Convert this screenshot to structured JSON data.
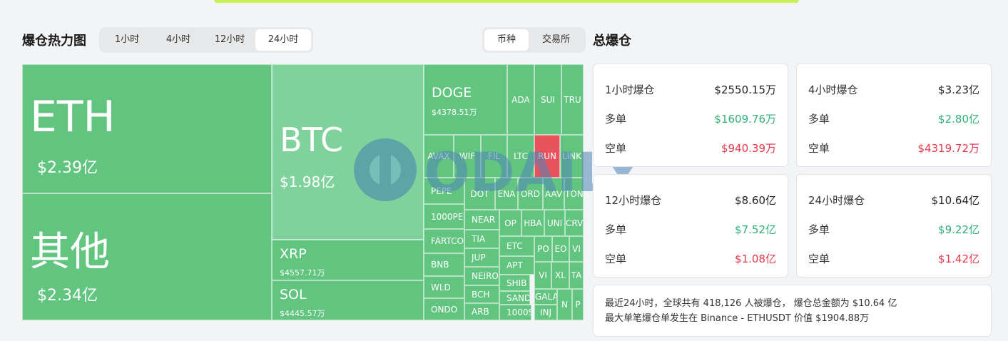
{
  "heatmap": {
    "title": "爆仓热力图",
    "ranges": [
      "1小时",
      "4小时",
      "12小时",
      "24小时"
    ],
    "active_range": "24小时",
    "types": [
      "币种",
      "交易所"
    ],
    "active_type": "币种",
    "tiles": {
      "eth": {
        "symbol": "ETH",
        "amount": "$2.39亿"
      },
      "other": {
        "symbol": "其他",
        "amount": "$2.34亿"
      },
      "btc": {
        "symbol": "BTC",
        "amount": "$1.98亿"
      },
      "xrp": {
        "symbol": "XRP",
        "amount": "$4557.71万"
      },
      "sol": {
        "symbol": "SOL",
        "amount": "$4445.57万"
      },
      "doge": {
        "symbol": "DOGE",
        "amount": "$4378.51万"
      },
      "ada": {
        "symbol": "ADA"
      },
      "sui": {
        "symbol": "SUI"
      },
      "trump": {
        "symbol": "TRU"
      },
      "avax": {
        "symbol": "AVAX"
      },
      "wif": {
        "symbol": "WIF"
      },
      "fil": {
        "symbol": "FIL"
      },
      "ltc": {
        "symbol": "LTC"
      },
      "rune": {
        "symbol": "RUN"
      },
      "link": {
        "symbol": "LINK"
      },
      "pepe": {
        "symbol": "PEPE"
      },
      "dot": {
        "symbol": "DOT"
      },
      "ena": {
        "symbol": "ENA"
      },
      "ordi": {
        "symbol": "ORD"
      },
      "aave": {
        "symbol": "AAV"
      },
      "ton": {
        "symbol": "TON"
      },
      "1000pepe": {
        "symbol": "1000PEP"
      },
      "near": {
        "symbol": "NEAR"
      },
      "op": {
        "symbol": "OP"
      },
      "hbar": {
        "symbol": "HBA"
      },
      "uni": {
        "symbol": "UNI"
      },
      "crv": {
        "symbol": "CRV"
      },
      "fartcoin": {
        "symbol": "FARTCOI"
      },
      "tia": {
        "symbol": "TIA"
      },
      "etc": {
        "symbol": "ETC"
      },
      "pol": {
        "symbol": "PO"
      },
      "eos": {
        "symbol": "EO"
      },
      "vi1": {
        "symbol": "VI"
      },
      "bnb": {
        "symbol": "BNB"
      },
      "jup": {
        "symbol": "JUP"
      },
      "apt": {
        "symbol": "APT"
      },
      "vi2": {
        "symbol": "VI"
      },
      "xlm": {
        "symbol": "XL"
      },
      "ta": {
        "symbol": "TA"
      },
      "wld": {
        "symbol": "WLD"
      },
      "neiro": {
        "symbol": "NEIRO"
      },
      "shib": {
        "symbol": "SHIB"
      },
      "bch": {
        "symbol": "BCH"
      },
      "sand": {
        "symbol": "SAND"
      },
      "gala": {
        "symbol": "GALA"
      },
      "ondo": {
        "symbol": "ONDO"
      },
      "arb": {
        "symbol": "ARB"
      },
      "1000s": {
        "symbol": "1000SA"
      },
      "inj": {
        "symbol": "INJ"
      },
      "n": {
        "symbol": "N"
      },
      "p": {
        "symbol": "P"
      }
    },
    "colors": {
      "long": "#61c47f",
      "long_light": "#80d29c",
      "short": "#e8525c"
    }
  },
  "total": {
    "title": "总爆仓",
    "cards": [
      {
        "label": "1小时爆仓",
        "total": "$2550.15万",
        "long_label": "多单",
        "long": "$1609.76万",
        "short_label": "空单",
        "short": "$940.39万"
      },
      {
        "label": "4小时爆仓",
        "total": "$3.23亿",
        "long_label": "多单",
        "long": "$2.80亿",
        "short_label": "空单",
        "short": "$4319.72万"
      },
      {
        "label": "12小时爆仓",
        "total": "$8.60亿",
        "long_label": "多单",
        "long": "$7.52亿",
        "short_label": "空单",
        "short": "$1.08亿"
      },
      {
        "label": "24小时爆仓",
        "total": "$10.64亿",
        "long_label": "多单",
        "long": "$9.22亿",
        "short_label": "空单",
        "short": "$1.42亿"
      }
    ],
    "summary_line1": "最近24小时，全球共有 418,126 人被爆仓， 爆仓总金额为 $10.64 亿",
    "summary_line2": "最大单笔爆仓单发生在 Binance - ETHUSDT 价值 $1904.88万"
  },
  "watermark": {
    "text": "ODAILY"
  }
}
